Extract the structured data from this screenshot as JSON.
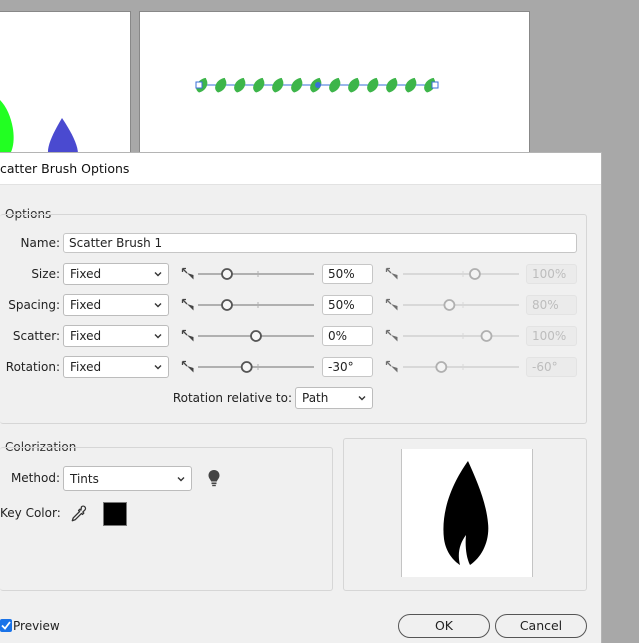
{
  "dialog": {
    "title": "catter Brush Options"
  },
  "options": {
    "group_label": "Options",
    "name_label": "Name:",
    "name_value": "Scatter Brush 1",
    "rows": [
      {
        "label": "Size:",
        "mode": "Fixed",
        "value": "50%",
        "max_value": "100%",
        "slider_fraction": 0.25,
        "max_fraction": 0.62
      },
      {
        "label": "Spacing:",
        "mode": "Fixed",
        "value": "50%",
        "max_value": "80%",
        "slider_fraction": 0.25,
        "max_fraction": 0.4
      },
      {
        "label": "Scatter:",
        "mode": "Fixed",
        "value": "0%",
        "max_value": "100%",
        "slider_fraction": 0.5,
        "max_fraction": 0.72
      },
      {
        "label": "Rotation:",
        "mode": "Fixed",
        "value": "-30°",
        "max_value": "-60°",
        "slider_fraction": 0.42,
        "max_fraction": 0.33
      }
    ],
    "rotation_relative_label": "Rotation relative to:",
    "rotation_relative_value": "Path"
  },
  "colorization": {
    "group_label": "Colorization",
    "method_label": "Method:",
    "method_value": "Tints",
    "key_color_label": "Key Color:",
    "key_color": "#000000"
  },
  "footer": {
    "preview_label": "Preview",
    "preview_checked": true,
    "ok_label": "OK",
    "cancel_label": "Cancel"
  },
  "colors": {
    "leaf_green": "#3db54a",
    "bright_green": "#22ff22",
    "blue_shape": "#4a4ad0",
    "selection_blue": "#3a6fd8",
    "checkbox_blue": "#1a73e8"
  },
  "icons": {
    "dropdown": "chevron-down-icon",
    "pen_pressure": "pen-pressure-icon",
    "tips": "lightbulb-icon",
    "eyedropper": "eyedropper-icon"
  }
}
